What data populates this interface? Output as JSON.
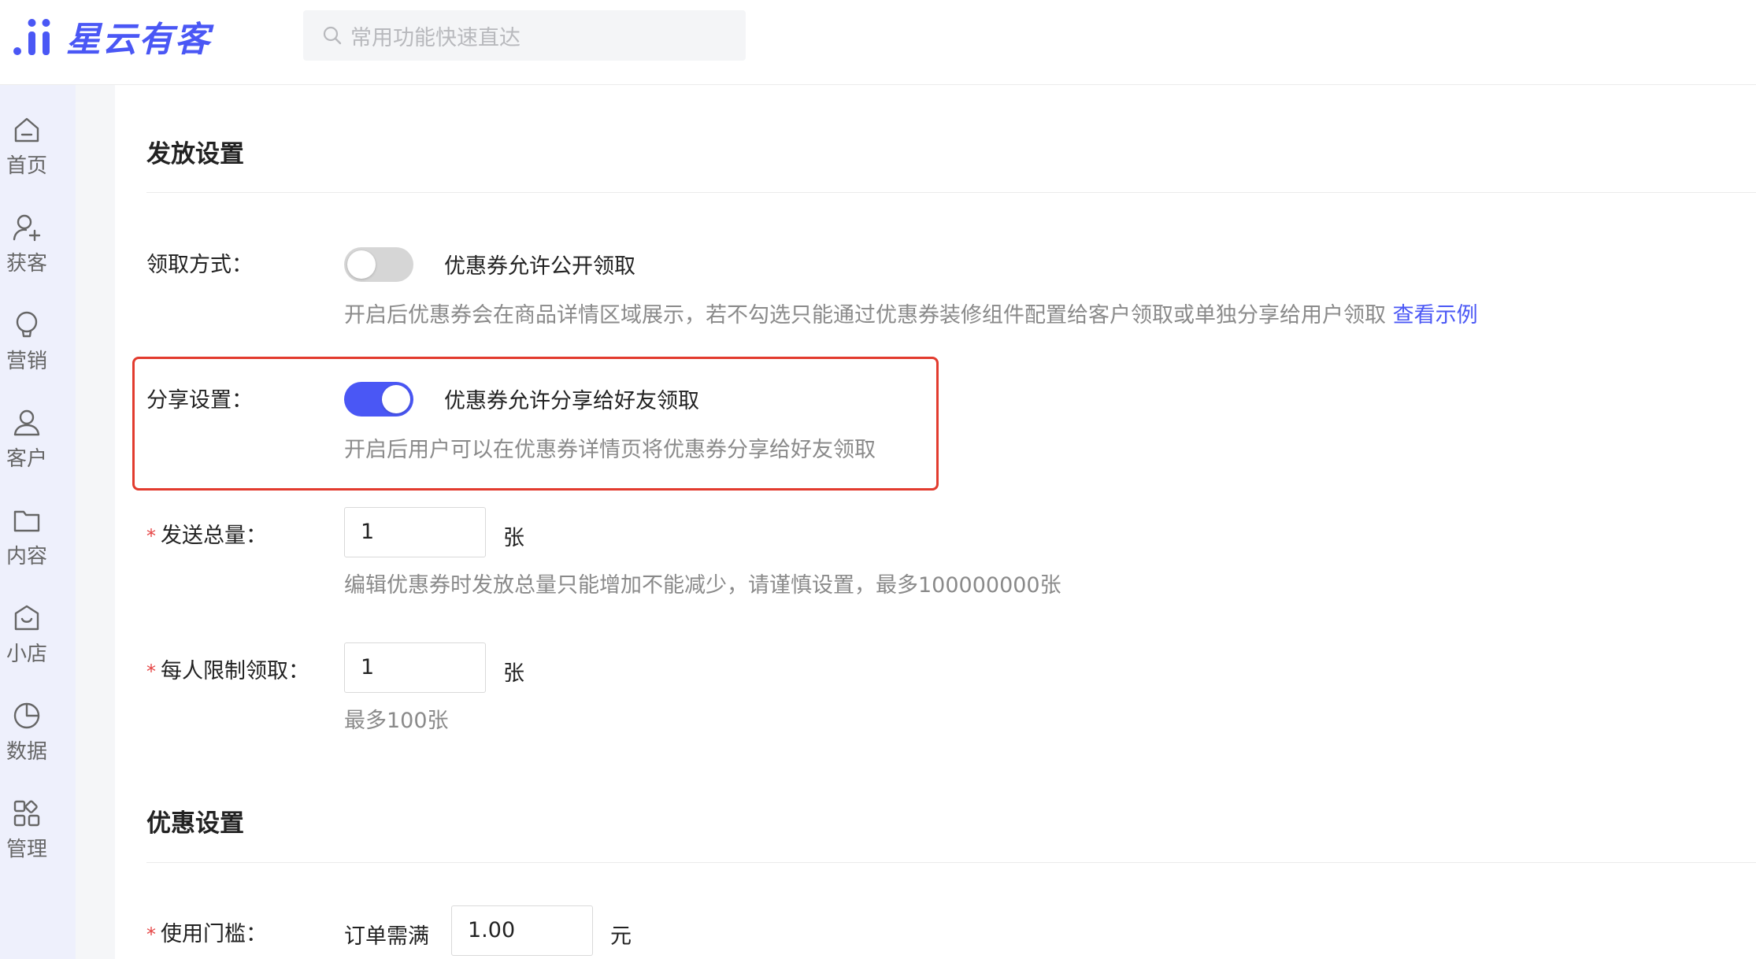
{
  "brand": {
    "name": "星云有客",
    "accent": "#4a57f5"
  },
  "search": {
    "placeholder": "常用功能快速直达"
  },
  "nav": [
    {
      "label": "首页",
      "icon": "home-icon"
    },
    {
      "label": "获客",
      "icon": "user-add-icon"
    },
    {
      "label": "营销",
      "icon": "bulb-icon"
    },
    {
      "label": "客户",
      "icon": "user-icon"
    },
    {
      "label": "内容",
      "icon": "folder-icon"
    },
    {
      "label": "小店",
      "icon": "shop-icon"
    },
    {
      "label": "数据",
      "icon": "pie-chart-icon"
    },
    {
      "label": "管理",
      "icon": "apps-icon"
    }
  ],
  "issue_section": {
    "title": "发放设置",
    "claim_method": {
      "label": "领取方式：",
      "toggle_on": false,
      "option_text": "优惠券允许公开领取",
      "help": "开启后优惠券会在商品详情区域展示，若不勾选只能通过优惠券装修组件配置给客户领取或单独分享给用户领取",
      "help_link": "查看示例"
    },
    "share_settings": {
      "label": "分享设置：",
      "toggle_on": true,
      "option_text": "优惠券允许分享给好友领取",
      "help": "开启后用户可以在优惠券详情页将优惠券分享给好友领取"
    },
    "total_quantity": {
      "required_mark": "*",
      "label": "发送总量：",
      "value": "1",
      "unit": "张",
      "help": "编辑优惠券时发放总量只能增加不能减少，请谨慎设置，最多100000000张"
    },
    "per_user_limit": {
      "required_mark": "*",
      "label": "每人限制领取：",
      "value": "1",
      "unit": "张",
      "help": "最多100张"
    }
  },
  "discount_section": {
    "title": "优惠设置",
    "threshold": {
      "required_mark": "*",
      "label": "使用门槛：",
      "prefix": "订单需满",
      "value": "1.00",
      "unit": "元"
    }
  }
}
